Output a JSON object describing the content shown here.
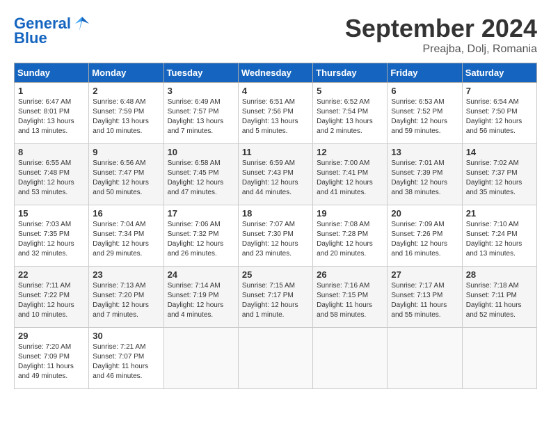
{
  "header": {
    "logo_line1": "General",
    "logo_line2": "Blue",
    "month_title": "September 2024",
    "location": "Preajba, Dolj, Romania"
  },
  "weekdays": [
    "Sunday",
    "Monday",
    "Tuesday",
    "Wednesday",
    "Thursday",
    "Friday",
    "Saturday"
  ],
  "weeks": [
    [
      {
        "day": "1",
        "info": "Sunrise: 6:47 AM\nSunset: 8:01 PM\nDaylight: 13 hours\nand 13 minutes."
      },
      {
        "day": "2",
        "info": "Sunrise: 6:48 AM\nSunset: 7:59 PM\nDaylight: 13 hours\nand 10 minutes."
      },
      {
        "day": "3",
        "info": "Sunrise: 6:49 AM\nSunset: 7:57 PM\nDaylight: 13 hours\nand 7 minutes."
      },
      {
        "day": "4",
        "info": "Sunrise: 6:51 AM\nSunset: 7:56 PM\nDaylight: 13 hours\nand 5 minutes."
      },
      {
        "day": "5",
        "info": "Sunrise: 6:52 AM\nSunset: 7:54 PM\nDaylight: 13 hours\nand 2 minutes."
      },
      {
        "day": "6",
        "info": "Sunrise: 6:53 AM\nSunset: 7:52 PM\nDaylight: 12 hours\nand 59 minutes."
      },
      {
        "day": "7",
        "info": "Sunrise: 6:54 AM\nSunset: 7:50 PM\nDaylight: 12 hours\nand 56 minutes."
      }
    ],
    [
      {
        "day": "8",
        "info": "Sunrise: 6:55 AM\nSunset: 7:48 PM\nDaylight: 12 hours\nand 53 minutes."
      },
      {
        "day": "9",
        "info": "Sunrise: 6:56 AM\nSunset: 7:47 PM\nDaylight: 12 hours\nand 50 minutes."
      },
      {
        "day": "10",
        "info": "Sunrise: 6:58 AM\nSunset: 7:45 PM\nDaylight: 12 hours\nand 47 minutes."
      },
      {
        "day": "11",
        "info": "Sunrise: 6:59 AM\nSunset: 7:43 PM\nDaylight: 12 hours\nand 44 minutes."
      },
      {
        "day": "12",
        "info": "Sunrise: 7:00 AM\nSunset: 7:41 PM\nDaylight: 12 hours\nand 41 minutes."
      },
      {
        "day": "13",
        "info": "Sunrise: 7:01 AM\nSunset: 7:39 PM\nDaylight: 12 hours\nand 38 minutes."
      },
      {
        "day": "14",
        "info": "Sunrise: 7:02 AM\nSunset: 7:37 PM\nDaylight: 12 hours\nand 35 minutes."
      }
    ],
    [
      {
        "day": "15",
        "info": "Sunrise: 7:03 AM\nSunset: 7:35 PM\nDaylight: 12 hours\nand 32 minutes."
      },
      {
        "day": "16",
        "info": "Sunrise: 7:04 AM\nSunset: 7:34 PM\nDaylight: 12 hours\nand 29 minutes."
      },
      {
        "day": "17",
        "info": "Sunrise: 7:06 AM\nSunset: 7:32 PM\nDaylight: 12 hours\nand 26 minutes."
      },
      {
        "day": "18",
        "info": "Sunrise: 7:07 AM\nSunset: 7:30 PM\nDaylight: 12 hours\nand 23 minutes."
      },
      {
        "day": "19",
        "info": "Sunrise: 7:08 AM\nSunset: 7:28 PM\nDaylight: 12 hours\nand 20 minutes."
      },
      {
        "day": "20",
        "info": "Sunrise: 7:09 AM\nSunset: 7:26 PM\nDaylight: 12 hours\nand 16 minutes."
      },
      {
        "day": "21",
        "info": "Sunrise: 7:10 AM\nSunset: 7:24 PM\nDaylight: 12 hours\nand 13 minutes."
      }
    ],
    [
      {
        "day": "22",
        "info": "Sunrise: 7:11 AM\nSunset: 7:22 PM\nDaylight: 12 hours\nand 10 minutes."
      },
      {
        "day": "23",
        "info": "Sunrise: 7:13 AM\nSunset: 7:20 PM\nDaylight: 12 hours\nand 7 minutes."
      },
      {
        "day": "24",
        "info": "Sunrise: 7:14 AM\nSunset: 7:19 PM\nDaylight: 12 hours\nand 4 minutes."
      },
      {
        "day": "25",
        "info": "Sunrise: 7:15 AM\nSunset: 7:17 PM\nDaylight: 12 hours\nand 1 minute."
      },
      {
        "day": "26",
        "info": "Sunrise: 7:16 AM\nSunset: 7:15 PM\nDaylight: 11 hours\nand 58 minutes."
      },
      {
        "day": "27",
        "info": "Sunrise: 7:17 AM\nSunset: 7:13 PM\nDaylight: 11 hours\nand 55 minutes."
      },
      {
        "day": "28",
        "info": "Sunrise: 7:18 AM\nSunset: 7:11 PM\nDaylight: 11 hours\nand 52 minutes."
      }
    ],
    [
      {
        "day": "29",
        "info": "Sunrise: 7:20 AM\nSunset: 7:09 PM\nDaylight: 11 hours\nand 49 minutes."
      },
      {
        "day": "30",
        "info": "Sunrise: 7:21 AM\nSunset: 7:07 PM\nDaylight: 11 hours\nand 46 minutes."
      },
      {
        "day": "",
        "info": ""
      },
      {
        "day": "",
        "info": ""
      },
      {
        "day": "",
        "info": ""
      },
      {
        "day": "",
        "info": ""
      },
      {
        "day": "",
        "info": ""
      }
    ]
  ]
}
